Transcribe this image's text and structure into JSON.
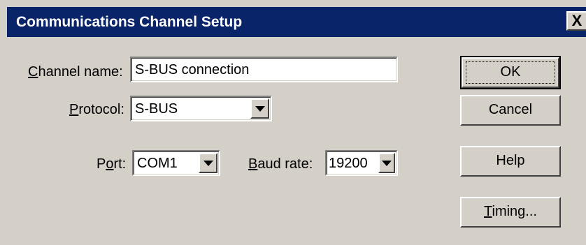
{
  "window": {
    "title": "Communications Channel Setup",
    "close_glyph": "X"
  },
  "form": {
    "channel_name": {
      "label_mnemonic": "C",
      "label_rest": "hannel name:",
      "value": "S-BUS connection"
    },
    "protocol": {
      "label_mnemonic": "P",
      "label_rest": "rotocol:",
      "value": "S-BUS"
    },
    "port": {
      "label_pre": "P",
      "label_mnemonic": "o",
      "label_rest": "rt:",
      "value": "COM1"
    },
    "baud_rate": {
      "label_mnemonic": "B",
      "label_rest": "aud rate:",
      "value": "19200"
    }
  },
  "buttons": {
    "ok": "OK",
    "cancel": "Cancel",
    "help": "Help",
    "timing_mnemonic": "T",
    "timing_rest": "iming..."
  },
  "colors": {
    "titlebar": "#0a246a",
    "face": "#d4d0c8"
  }
}
